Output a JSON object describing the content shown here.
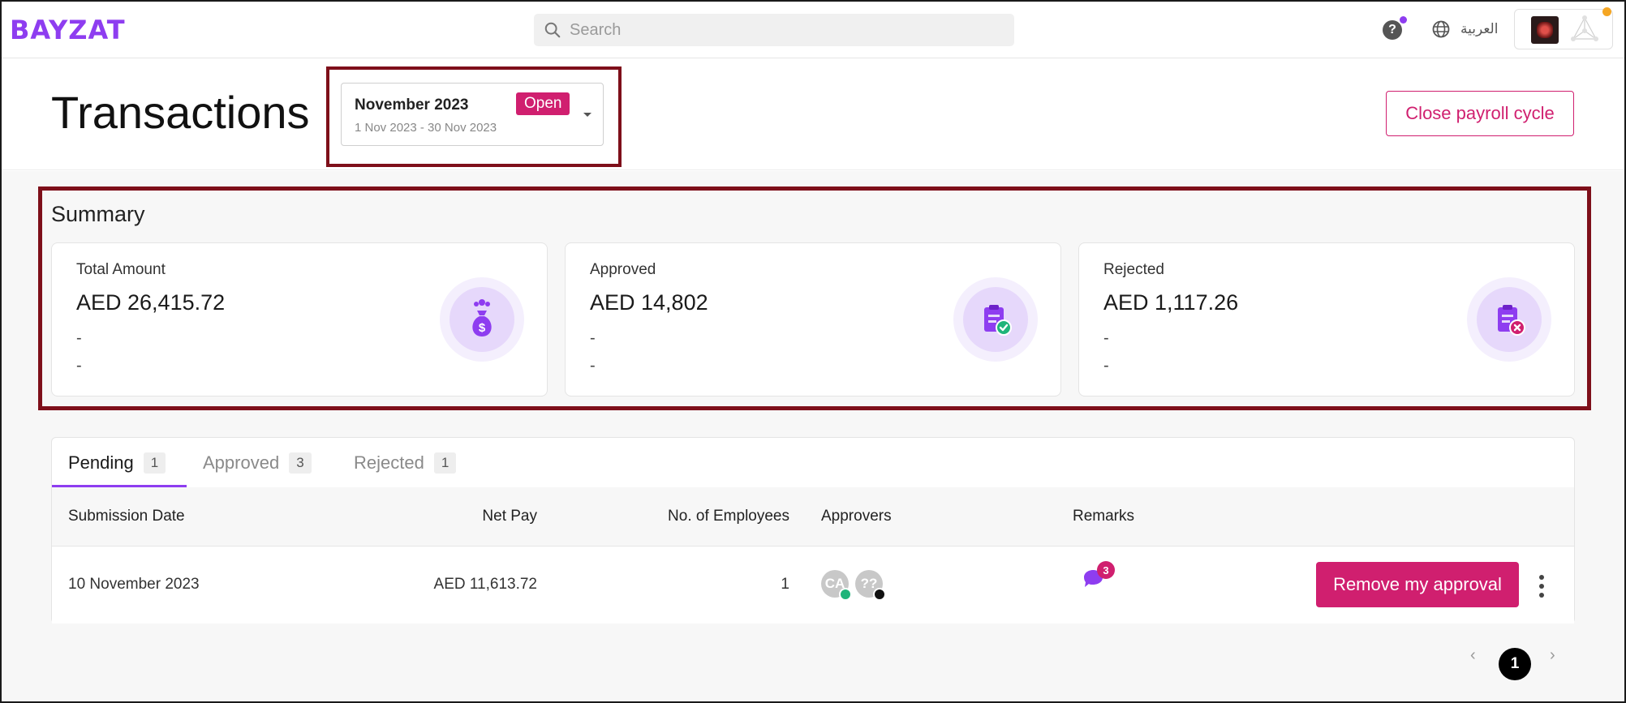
{
  "topbar": {
    "logo": "BAYZAT",
    "search_placeholder": "Search",
    "help_label": "?",
    "language": "العربية"
  },
  "header": {
    "title": "Transactions",
    "period": {
      "name": "November 2023",
      "status": "Open",
      "range": "1 Nov 2023 - 30 Nov 2023"
    },
    "close_cycle_label": "Close payroll cycle"
  },
  "summary": {
    "title": "Summary",
    "cards": [
      {
        "label": "Total Amount",
        "value": "AED 26,415.72",
        "line1": "-",
        "line2": "-",
        "icon": "money-bag-icon"
      },
      {
        "label": "Approved",
        "value": "AED 14,802",
        "line1": "-",
        "line2": "-",
        "icon": "clipboard-check-icon"
      },
      {
        "label": "Rejected",
        "value": "AED 1,117.26",
        "line1": "-",
        "line2": "-",
        "icon": "clipboard-x-icon"
      }
    ]
  },
  "tabs": [
    {
      "label": "Pending",
      "count": "1"
    },
    {
      "label": "Approved",
      "count": "3"
    },
    {
      "label": "Rejected",
      "count": "1"
    }
  ],
  "table": {
    "headers": {
      "submission_date": "Submission Date",
      "net_pay": "Net Pay",
      "employees": "No. of Employees",
      "approvers": "Approvers",
      "remarks": "Remarks"
    },
    "rows": [
      {
        "submission_date": "10 November 2023",
        "net_pay": "AED 11,613.72",
        "employees": "1",
        "approvers": [
          "CA",
          "??"
        ],
        "remarks_count": "3",
        "action_label": "Remove my approval"
      }
    ]
  },
  "pagination": {
    "current_page": "1",
    "prev": "‹",
    "next": "›"
  },
  "colors": {
    "brand": "#8e3df0",
    "accent": "#d01f6f",
    "highlight": "#7e0f1a"
  }
}
